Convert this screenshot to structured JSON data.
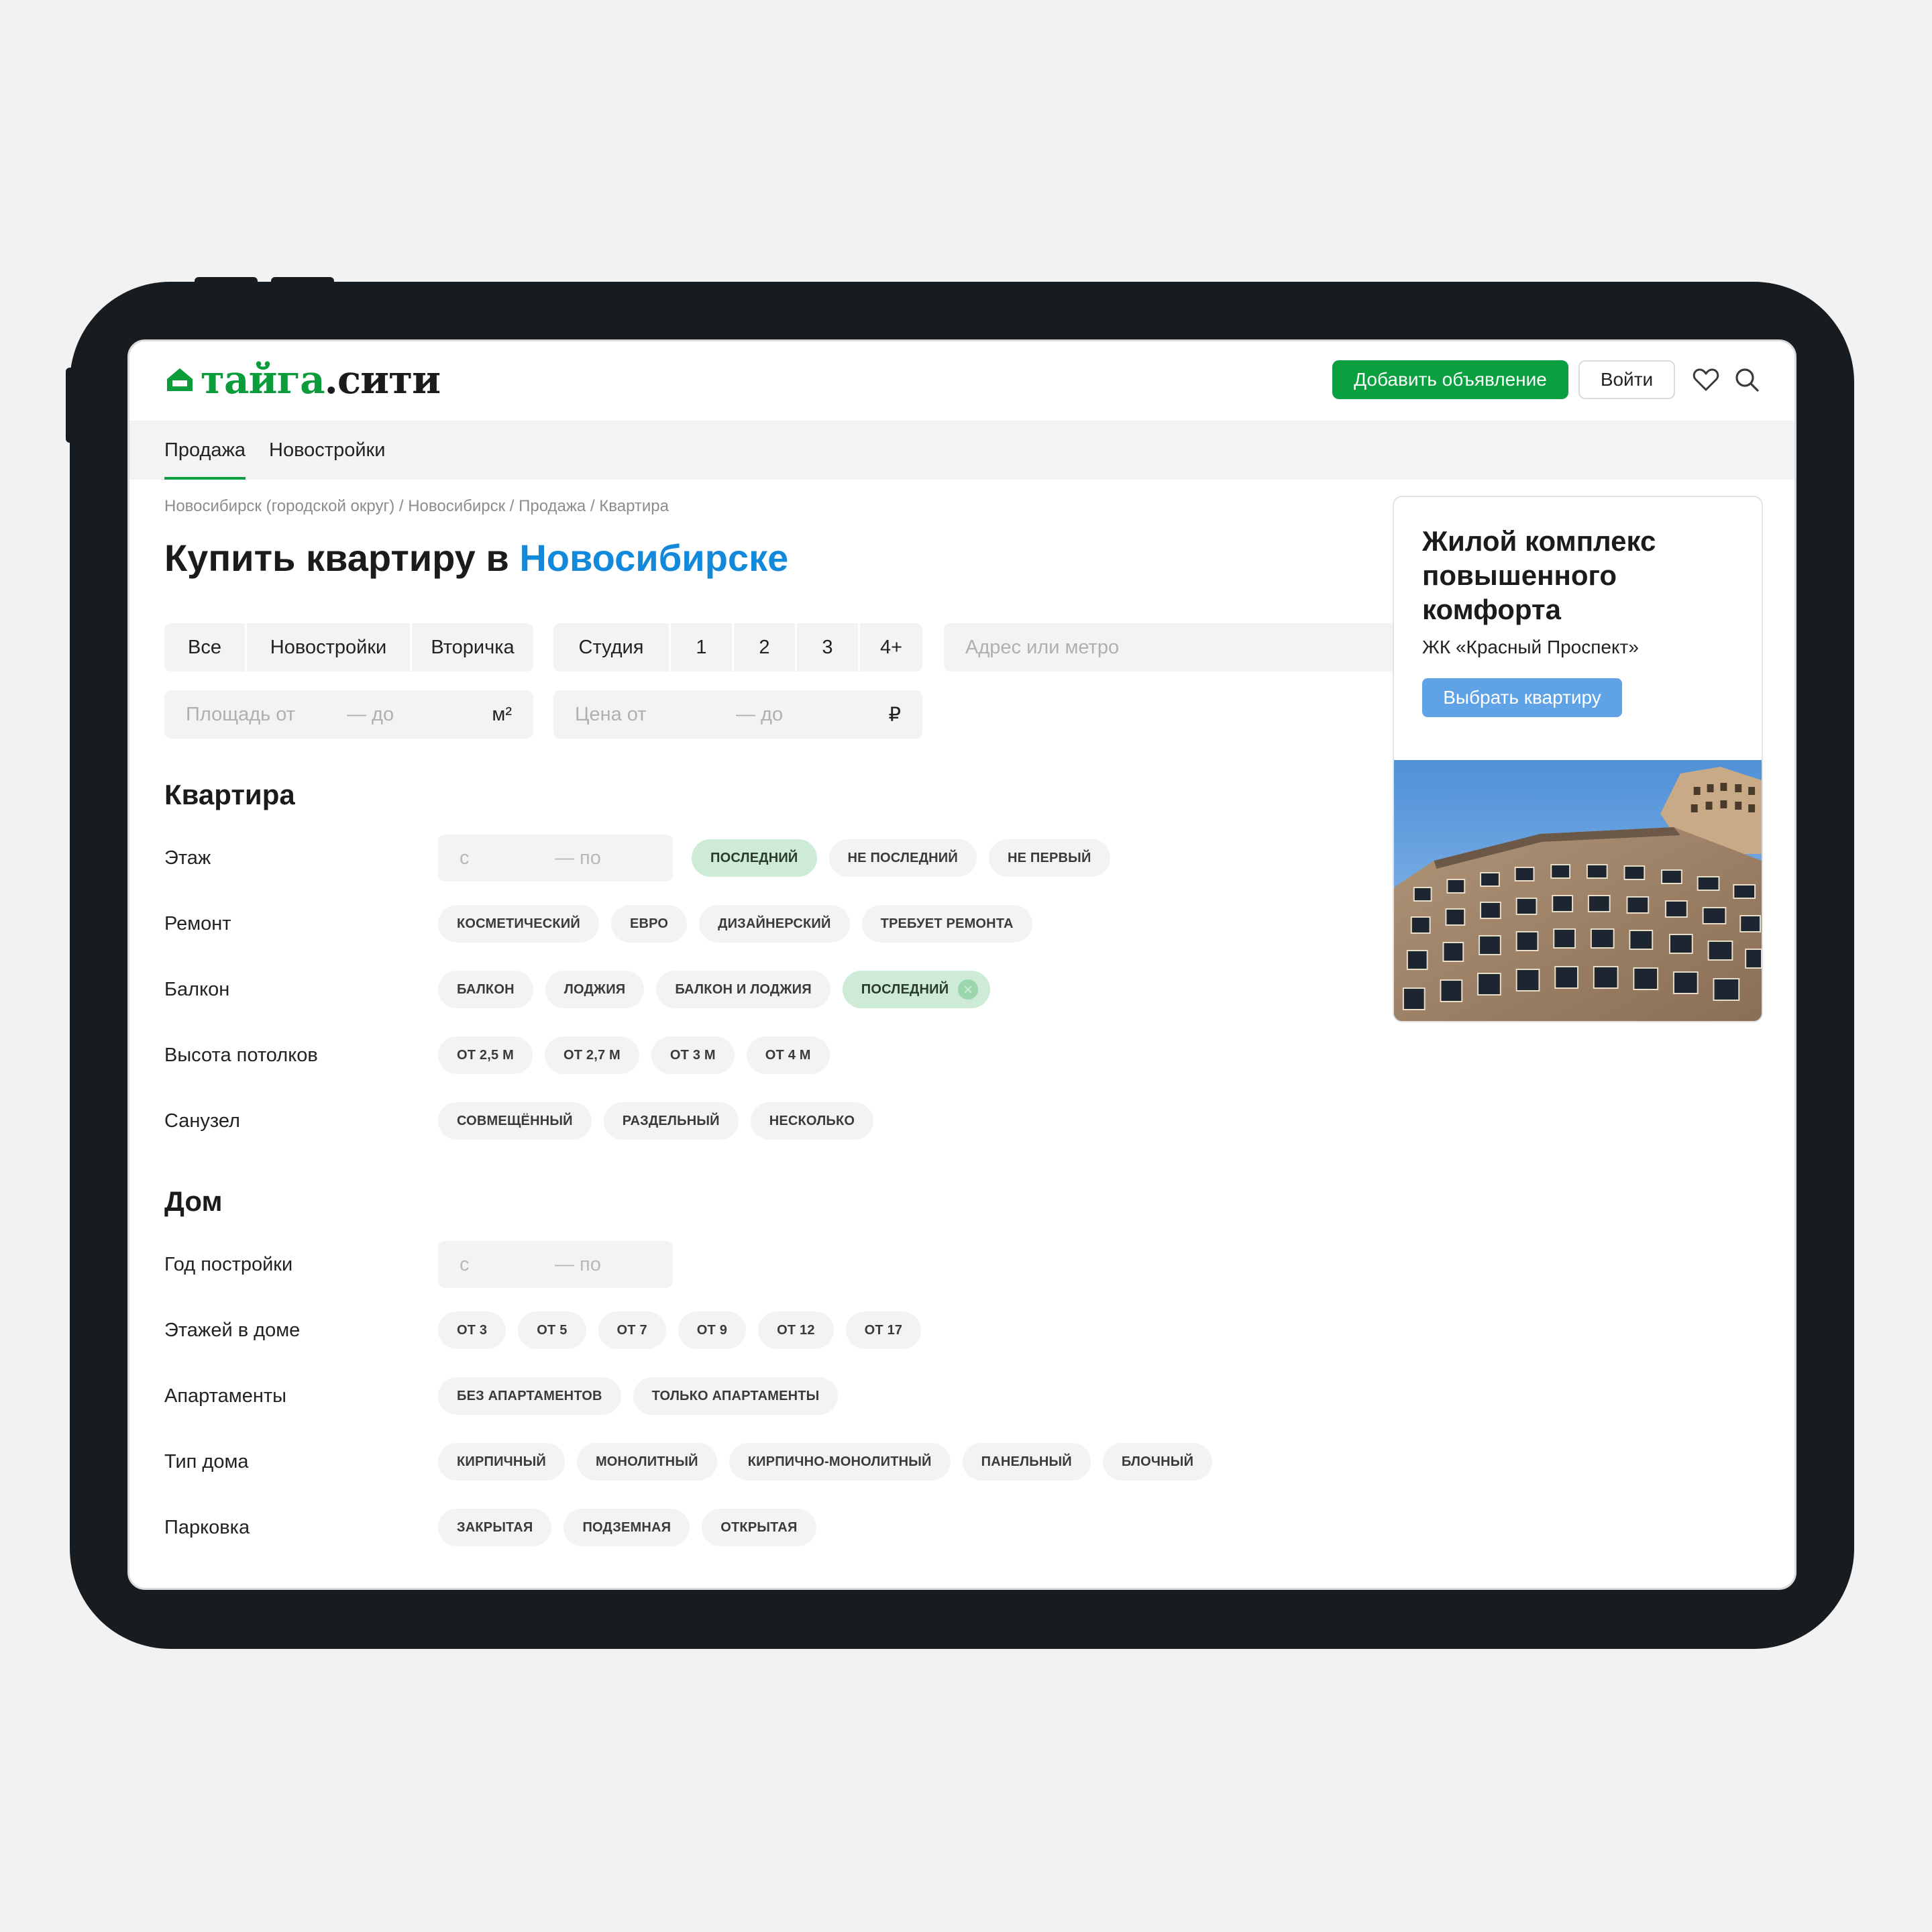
{
  "header": {
    "logo_part1": "тайга",
    "logo_part2": ".сити",
    "add_button": "Добавить объявление",
    "login_button": "Войти"
  },
  "nav": {
    "tabs": [
      "Продажа",
      "Новостройки"
    ],
    "active_index": 0
  },
  "breadcrumb": "Новосибирск (городской округ) / Новосибирск / Продажа / Квартира",
  "title": {
    "prefix": "Купить квартиру в ",
    "city": "Новосибирске"
  },
  "filters": {
    "market": [
      "Все",
      "Новостройки",
      "Вторичка"
    ],
    "rooms": [
      "Студия",
      "1",
      "2",
      "3",
      "4+"
    ],
    "address_placeholder": "Адрес или метро",
    "area": {
      "from": "Площадь от",
      "to": "— до",
      "unit": "м²"
    },
    "price": {
      "from": "Цена от",
      "to": "— до",
      "unit": "₽"
    }
  },
  "apartment": {
    "title": "Квартира",
    "floor": {
      "label": "Этаж",
      "from": "с",
      "to": "— по",
      "chips": [
        "ПОСЛЕДНИЙ",
        "НЕ ПОСЛЕДНИЙ",
        "НЕ ПЕРВЫЙ"
      ],
      "selected": [
        0
      ]
    },
    "repair": {
      "label": "Ремонт",
      "chips": [
        "КОСМЕТИЧЕСКИЙ",
        "ЕВРО",
        "ДИЗАЙНЕРСКИЙ",
        "ТРЕБУЕТ РЕМОНТА"
      ]
    },
    "balcony": {
      "label": "Балкон",
      "chips": [
        "БАЛКОН",
        "ЛОДЖИЯ",
        "БАЛКОН И ЛОДЖИЯ",
        "ПОСЛЕДНИЙ"
      ],
      "selected": [
        3
      ]
    },
    "ceiling": {
      "label": "Высота потолков",
      "chips": [
        "ОТ 2,5 М",
        "ОТ 2,7 М",
        "ОТ 3 М",
        "ОТ 4 М"
      ]
    },
    "bathroom": {
      "label": "Санузел",
      "chips": [
        "СОВМЕЩЁННЫЙ",
        "РАЗДЕЛЬНЫЙ",
        "НЕСКОЛЬКО"
      ]
    }
  },
  "house": {
    "title": "Дом",
    "year": {
      "label": "Год постройки",
      "from": "с",
      "to": "— по"
    },
    "floors": {
      "label": "Этажей в доме",
      "chips": [
        "ОТ 3",
        "ОТ 5",
        "ОТ 7",
        "ОТ 9",
        "ОТ 12",
        "ОТ 17"
      ]
    },
    "apartments": {
      "label": "Апартаменты",
      "chips": [
        "БЕЗ АПАРТАМЕНТОВ",
        "ТОЛЬКО АПАРТАМЕНТЫ"
      ]
    },
    "type": {
      "label": "Тип дома",
      "chips": [
        "КИРПИЧНЫЙ",
        "МОНОЛИТНЫЙ",
        "КИРПИЧНО-МОНОЛИТНЫЙ",
        "ПАНЕЛЬНЫЙ",
        "БЛОЧНЫЙ"
      ]
    },
    "parking": {
      "label": "Парковка",
      "chips": [
        "ЗАКРЫТАЯ",
        "ПОДЗЕМНАЯ",
        "ОТКРЫТАЯ"
      ]
    }
  },
  "ad": {
    "title": "Жилой комплекс повышенного комфорта",
    "subtitle": "ЖК «Красный Проспект»",
    "button": "Выбрать квартиру"
  },
  "colors": {
    "brand_green": "#0aa03f",
    "accent_blue": "#1389db",
    "chip_selected": "#cdebd6",
    "ad_button": "#5fa3e6"
  }
}
